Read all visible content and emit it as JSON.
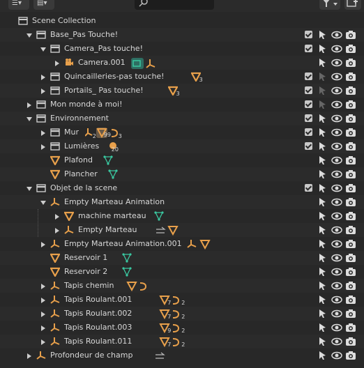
{
  "outliner": {
    "rows": [
      {
        "label": "Scene Collection",
        "kind": "scene",
        "indent": 0
      },
      {
        "label": "Base_Pas Touche!",
        "kind": "collection",
        "indent": 1,
        "expanded": true,
        "checked": true
      },
      {
        "label": "Camera_Pas touche!",
        "kind": "collection",
        "indent": 2,
        "expanded": true,
        "checked": true
      },
      {
        "label": "Camera.001",
        "kind": "camera",
        "indent": 3
      },
      {
        "label": "Quincailleries-pas touche!",
        "kind": "collection",
        "indent": 2,
        "checked": true,
        "count": "3"
      },
      {
        "label": "Portails_ Pas touche!",
        "kind": "collection",
        "indent": 2,
        "checked": true,
        "count": "3"
      },
      {
        "label": "Mon monde à moi!",
        "kind": "collection",
        "indent": 1,
        "checked": true
      },
      {
        "label": "Environnement",
        "kind": "collection",
        "indent": 1,
        "expanded": true,
        "checked": true
      },
      {
        "label": "Mur",
        "kind": "collection",
        "indent": 2,
        "checked": true,
        "count": "2",
        "count2": "99",
        "count3": "3"
      },
      {
        "label": "Lumières",
        "kind": "collection",
        "indent": 2,
        "checked": true,
        "count": "20"
      },
      {
        "label": "Plafond",
        "kind": "mesh",
        "indent": 2
      },
      {
        "label": "Plancher",
        "kind": "mesh",
        "indent": 2
      },
      {
        "label": "Objet de la scene",
        "kind": "collection",
        "indent": 1,
        "expanded": true,
        "checked": true
      },
      {
        "label": "Empty Marteau Animation",
        "kind": "empty",
        "indent": 2,
        "expanded": true
      },
      {
        "label": "machine marteau",
        "kind": "mesh",
        "indent": 3
      },
      {
        "label": "Empty Marteau",
        "kind": "empty",
        "indent": 3
      },
      {
        "label": "Empty Marteau Animation.001",
        "kind": "empty",
        "indent": 2
      },
      {
        "label": "Reservoir 1",
        "kind": "mesh",
        "indent": 2
      },
      {
        "label": "Reservoir 2",
        "kind": "mesh",
        "indent": 2
      },
      {
        "label": "Tapis chemin",
        "kind": "empty",
        "indent": 2
      },
      {
        "label": "Tapis Roulant.001",
        "kind": "empty",
        "indent": 2,
        "count": "7",
        "count2": "2"
      },
      {
        "label": "Tapis Roulant.002",
        "kind": "empty",
        "indent": 2,
        "count": "7",
        "count2": "2"
      },
      {
        "label": "Tapis Roulant.003",
        "kind": "empty",
        "indent": 2,
        "count": "9",
        "count2": "2"
      },
      {
        "label": "Tapis Roulant.011",
        "kind": "empty",
        "indent": 2,
        "count": "7",
        "count2": "2"
      },
      {
        "label": "Profondeur de champ",
        "kind": "empty",
        "indent": 1
      }
    ]
  },
  "colors": {
    "accent": "#e8a04b",
    "mesh_data": "#3ac7a0",
    "bg": "#282828",
    "row_alt": "#2b2b2b"
  }
}
